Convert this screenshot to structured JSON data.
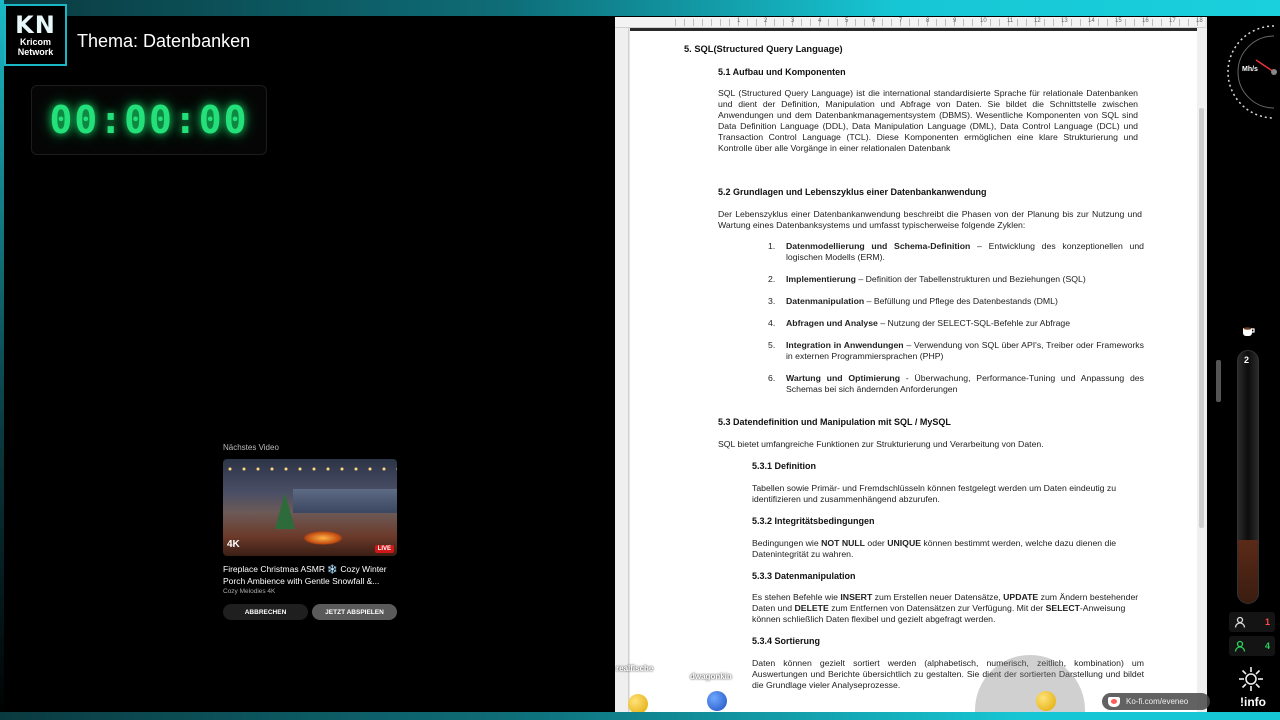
{
  "branding": {
    "logo_main": "KN",
    "logo_line1": "Kricom",
    "logo_line2": "Network",
    "theme_title": "Thema: Datenbanken"
  },
  "timer": {
    "value": "00:00:00"
  },
  "next_video": {
    "label": "Nächstes Video",
    "title": "Fireplace Christmas ASMR ❄️ Cozy Winter Porch Ambience with Gentle Snowfall &...",
    "channel": "Cozy Melodies 4K",
    "badge_4k": "4K",
    "live_badge": "LIVE",
    "cancel_label": "ABBRECHEN",
    "play_label": "JETZT ABSPIELEN"
  },
  "ruler": {
    "numbers": [
      "1",
      "2",
      "3",
      "4",
      "5",
      "6",
      "7",
      "8",
      "9",
      "10",
      "11",
      "12",
      "13",
      "14",
      "15",
      "16",
      "17",
      "18"
    ]
  },
  "document": {
    "h5": "5. SQL(Structured Query Language)",
    "h51": "5.1 Aufbau und Komponenten",
    "p1": "SQL (Structured Query Language) ist die international standardisierte Sprache für relationale Datenbanken und dient der Definition, Manipulation und Abfrage von Daten. Sie bildet die Schnittstelle zwischen Anwendungen und dem Datenbankmanagementsystem (DBMS). Wesentliche Komponenten von SQL sind Data Definition Language (DDL), Data Manipulation Language (DML), Data Control Language (DCL) und Transaction Control Language (TCL). Diese Komponenten ermöglichen eine klare Strukturierung und Kontrolle über alle Vorgänge in einer relationalen Datenbank",
    "h52": "5.2 Grundlagen und Lebenszyklus einer Datenbankanwendung",
    "p2": "Der Lebenszyklus einer Datenbankanwendung beschreibt die Phasen von der Planung bis zur Nutzung und Wartung eines Datenbanksystems und umfasst typischerweise folgende Zyklen:",
    "list": [
      {
        "num": "1.",
        "bold": "Datenmodellierung und Schema-Definition",
        "text": " – Entwicklung des konzeptionellen und                      logischen Modells (ERM)."
      },
      {
        "num": "2.",
        "bold": "Implementierung",
        "text": " – Definition der Tabellenstrukturen und Beziehungen (SQL)"
      },
      {
        "num": "3.",
        "bold": "Datenmanipulation",
        "text": " – Befüllung und Pflege des Datenbestands (DML)"
      },
      {
        "num": "4.",
        "bold": "Abfragen und Analyse",
        "text": " – Nutzung der SELECT-SQL-Befehle zur Abfrage"
      },
      {
        "num": "5.",
        "bold": "Integration in Anwendungen",
        "text": " – Verwendung von SQL über API's, Treiber oder Frameworks in externen Programmiersprachen (PHP)"
      },
      {
        "num": "6.",
        "bold": "Wartung und Optimierung",
        "text": " - Überwachung, Performance-Tuning und Anpassung des Schemas bei sich ändernden Anforderungen"
      }
    ],
    "h53": "5.3 Datendefinition und Manipulation mit SQL / MySQL",
    "p3": "SQL bietet umfangreiche Funktionen zur Strukturierung und Verarbeitung von Daten.",
    "h531": "5.3.1 Definition",
    "p531": "Tabellen sowie Primär- und Fremdschlüsseln können festgelegt werden um Daten eindeutig zu identifizieren und zusammenhängend abzurufen.",
    "h532": "5.3.2 Integritätsbedingungen",
    "p532_a": "Bedingungen wie ",
    "p532_b1": "NOT NULL",
    "p532_c": " oder ",
    "p532_b2": "UNIQUE",
    "p532_d": " können bestimmt werden, welche dazu dienen die Datenintegrität zu wahren.",
    "h533": "5.3.3 Datenmanipulation",
    "p533_a": "Es stehen Befehle wie ",
    "p533_b1": "INSERT",
    "p533_c": " zum Erstellen neuer Datensätze, ",
    "p533_b2": "UPDATE",
    "p533_d": " zum Ändern bestehender Daten und ",
    "p533_b3": "DELETE",
    "p533_e": " zum Entfernen von Datensätzen zur Verfügung. Mit der ",
    "p533_b4": "SELECT",
    "p533_f": "-Anweisung können schließlich Daten flexibel und gezielt abgefragt werden.",
    "h534": "5.3.4 Sortierung",
    "p534": "Daten können gezielt sortiert werden (alphabetisch, numerisch, zeitlich, kombination) um Auswertungen und Berichte übersichtlich zu gestalten. Sie dient der sortierten Darstellung und bildet die Grundlage vieler Analyseprozesse."
  },
  "overlay": {
    "name1": "realfische",
    "name2": "dwagonkin",
    "kofi": "Ko-fi.com/eveneo"
  },
  "right_panel": {
    "speed_unit": "Mh/s",
    "tube_count": "2",
    "tube_fill": 0.25,
    "viewers": "1",
    "active": "4",
    "info": "!info"
  },
  "colors": {
    "accent": "#19b7c4",
    "timer": "#23e07a",
    "active_green": "#2ad05a",
    "viewer_red": "#ff4a4a"
  }
}
